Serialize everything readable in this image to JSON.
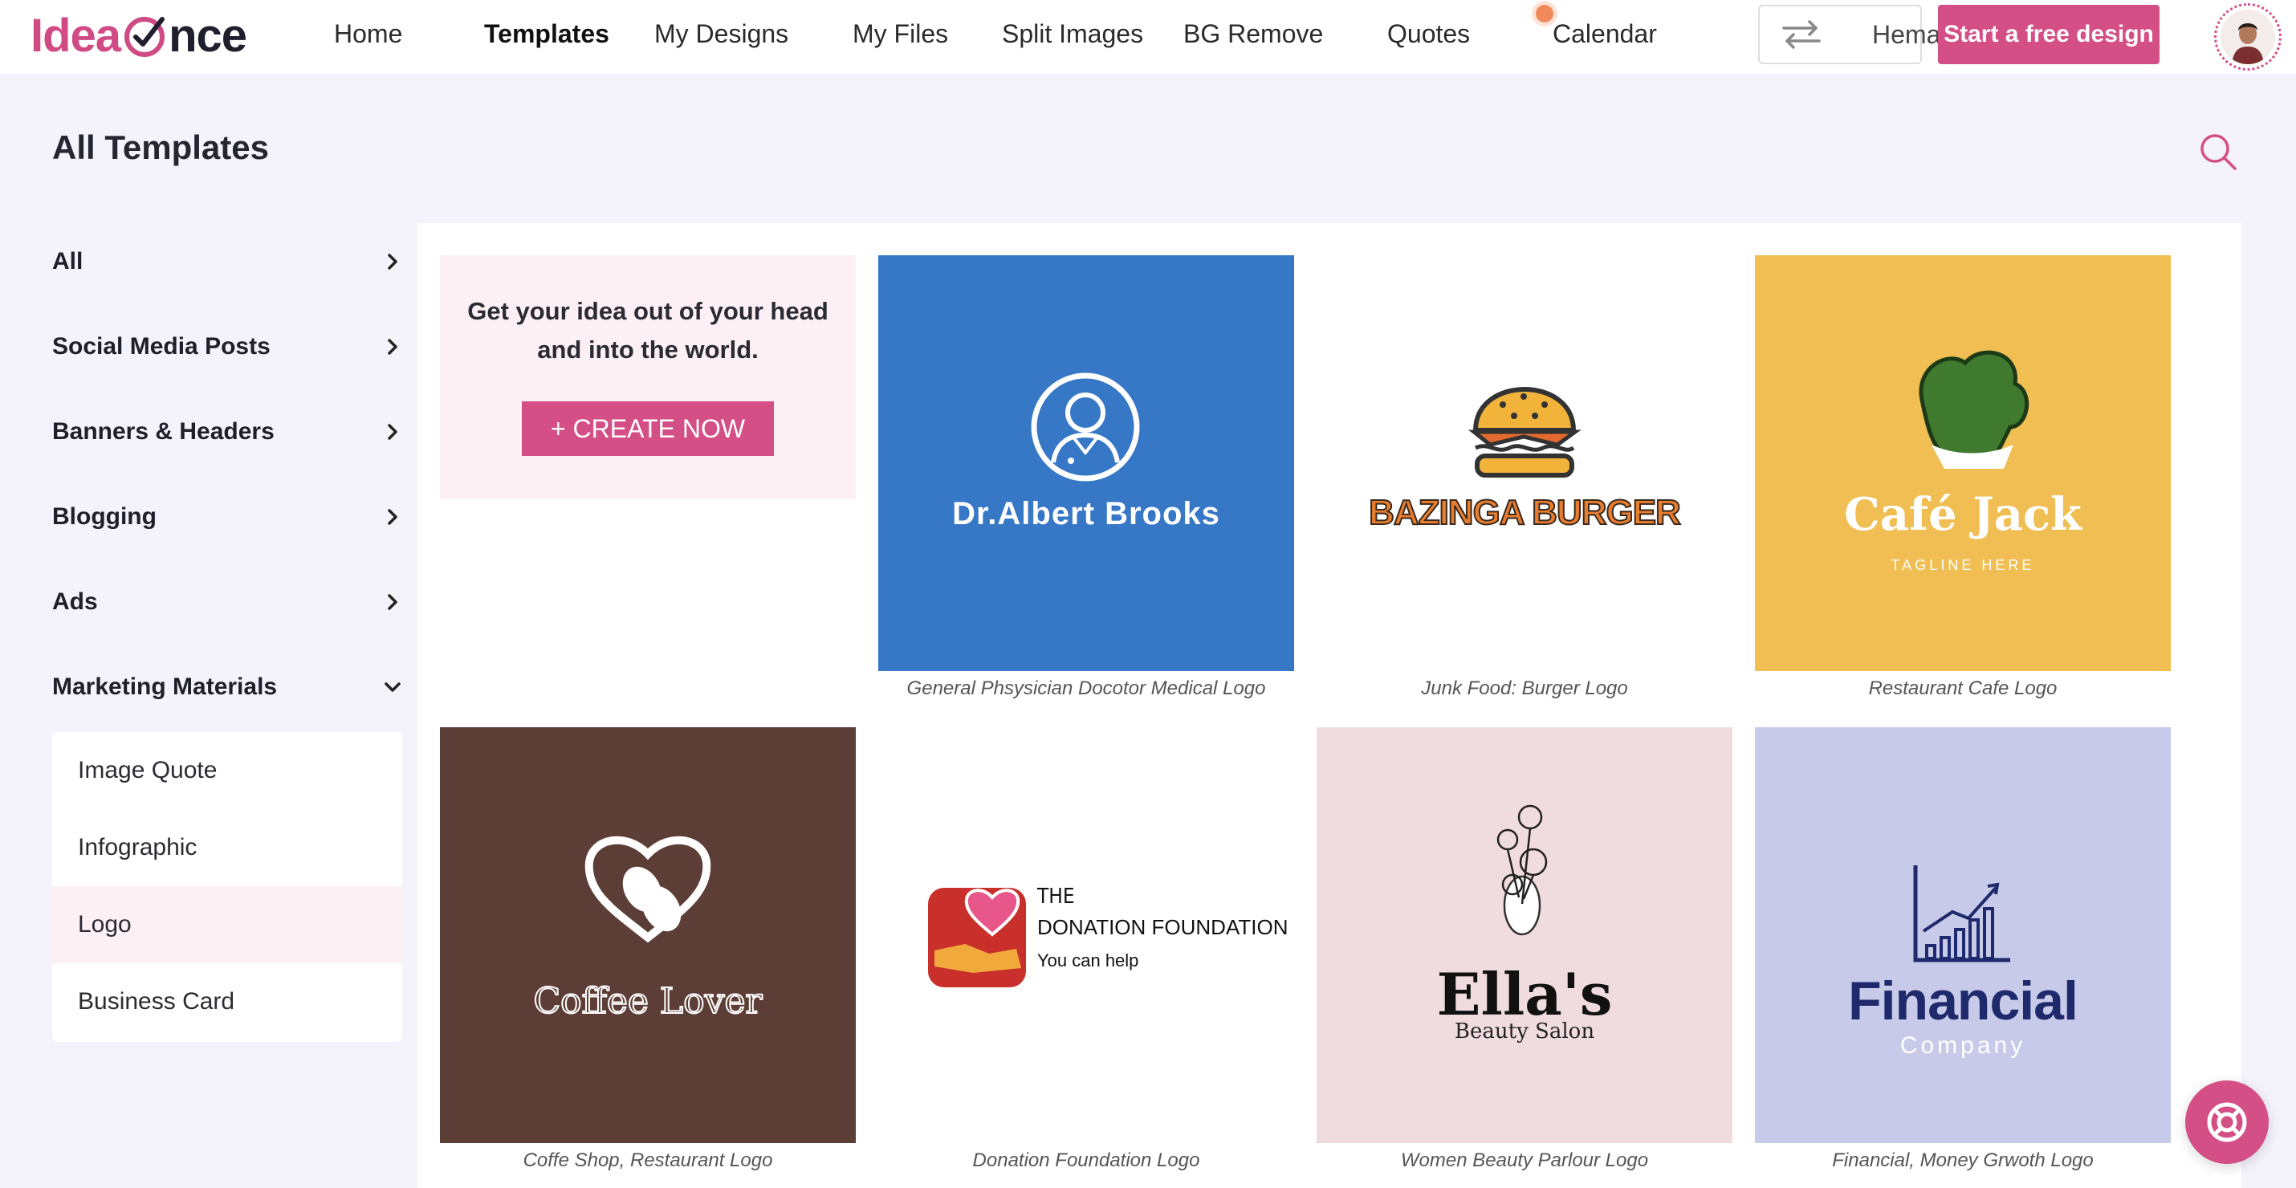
{
  "brand": {
    "part1": "Idea",
    "part2": "nce",
    "accent": "#d34f85"
  },
  "nav": {
    "items": [
      "Home",
      "Templates",
      "My Designs",
      "My Files",
      "Split Images",
      "BG Remove",
      "Quotes",
      "Calendar"
    ],
    "active": "Templates"
  },
  "account": {
    "switch_label": "Hema",
    "cta_label": "Start a free design"
  },
  "page": {
    "title": "All Templates"
  },
  "sidebar": {
    "categories": [
      "All",
      "Social Media Posts",
      "Banners & Headers",
      "Blogging",
      "Ads",
      "Marketing Materials"
    ],
    "expanded": "Marketing Materials",
    "subitems": [
      "Image Quote",
      "Infographic",
      "Logo",
      "Business Card"
    ],
    "active_subitem": "Logo"
  },
  "promo": {
    "text": "Get your idea out of your head and into the world.",
    "button": "+ CREATE NOW"
  },
  "templates": [
    {
      "caption": "General Phsysician Docotor Medical Logo",
      "title": "Dr.Albert Brooks",
      "bg": "#3677c6"
    },
    {
      "caption": "Junk Food: Burger Logo",
      "title": "BAZINGA BURGER",
      "bg": "#ffffff"
    },
    {
      "caption": "Restaurant Cafe Logo",
      "title": "Café Jack",
      "subtitle": "TAGLINE HERE",
      "bg": "#f0be52"
    },
    {
      "caption": "Coffe Shop, Restaurant Logo",
      "title": "Coffee Lover",
      "bg": "#5c3e36"
    },
    {
      "caption": "Donation Foundation Logo",
      "line1": "THE",
      "line2": "DONATION FOUNDATION",
      "line3": "You can help",
      "bg": "#ffffff"
    },
    {
      "caption": "Women Beauty Parlour Logo",
      "title": "Ella's",
      "subtitle": "Beauty Salon",
      "bg": "#f0dcde"
    },
    {
      "caption": "Financial, Money Grwoth Logo",
      "title": "Financial",
      "subtitle": "Company",
      "bg": "#c7cae9"
    }
  ]
}
